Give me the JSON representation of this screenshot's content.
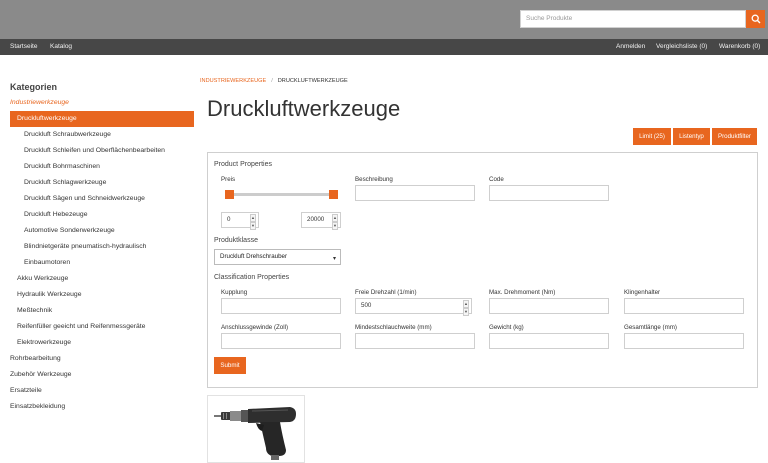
{
  "search": {
    "placeholder": "Suche Produkte"
  },
  "nav": {
    "left": [
      "Startseite",
      "Katalog"
    ],
    "right": [
      "Anmelden",
      "Vergleichsliste (0)",
      "Warenkorb (0)"
    ]
  },
  "sidebar": {
    "title": "Kategorien",
    "items": [
      "Industriewerkzeuge",
      "Druckluftwerkzeuge",
      "Druckluft Schraubwerkzeuge",
      "Druckluft Schleifen und Oberflächenbearbeiten",
      "Druckluft Bohrmaschinen",
      "Druckluft Schlagwerkzeuge",
      "Druckluft Sägen und Schneidwerkzeuge",
      "Druckluft Hebezeuge",
      "Automotive Sonderwerkzeuge",
      "Blindnietgeräte pneumatisch-hydraulisch",
      "Einbaumotoren",
      "Akku Werkzeuge",
      "Hydraulik Werkzeuge",
      "Meßtechnik",
      "Reifenfüller geeicht und Reifenmessgeräte",
      "Elektrowerkzeuge",
      "Rohrbearbeitung",
      "Zubehör Werkzeuge",
      "Ersatzteile",
      "Einsatzbekleidung"
    ]
  },
  "breadcrumb": {
    "parent": "INDUSTRIEWERKZEUGE",
    "separator": "/",
    "current": "DRUCKLUFTWERKZEUGE"
  },
  "page": {
    "title": "Druckluftwerkzeuge"
  },
  "toolbar": {
    "limit": "Limit (25)",
    "list_type": "Listentyp",
    "product_filter": "Produktfilter"
  },
  "filter": {
    "product_properties": "Product Properties",
    "price_label": "Preis",
    "price_min": "0",
    "price_max": "20000",
    "description_label": "Beschreibung",
    "code_label": "Code",
    "product_class_label": "Produktklasse",
    "product_class_value": "Druckluft Drehschrauber",
    "classification_properties": "Classification Properties",
    "coupling_label": "Kupplung",
    "free_speed_label": "Freie Drehzahl (1/min)",
    "free_speed_value": "500",
    "max_torque_label": "Max. Drehmoment (Nm)",
    "blade_holder_label": "Klingenhalter",
    "thread_label": "Anschlussgewinde (Zoll)",
    "min_hose_label": "Mindestschlauchweite (mm)",
    "weight_label": "Gewicht (kg)",
    "total_length_label": "Gesamtlänge (mm)",
    "submit": "Submit"
  },
  "colors": {
    "accent": "#e8661f",
    "topbar": "#8a8a8a",
    "navbar": "#474747"
  }
}
